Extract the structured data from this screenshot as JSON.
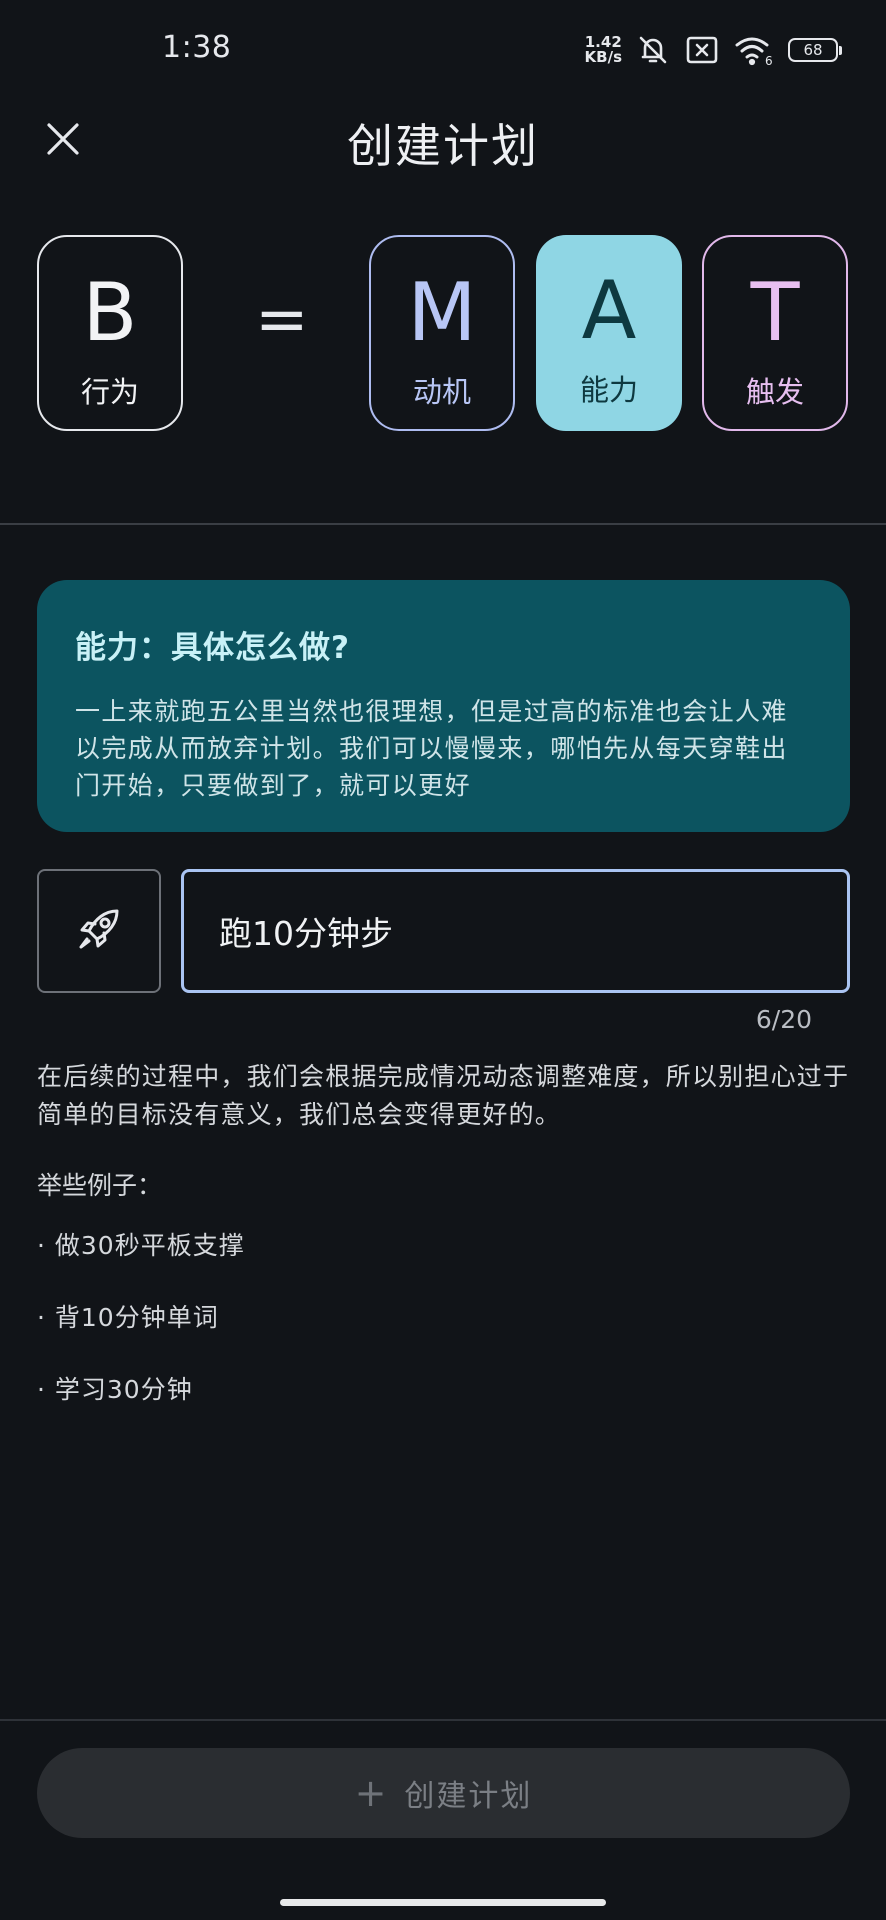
{
  "status_bar": {
    "time": "1:38",
    "net_speed_value": "1.42",
    "net_speed_unit": "KB/s",
    "battery_level": "68",
    "icons": [
      "bell-muted-icon",
      "sim-disabled-icon",
      "wifi-6-icon",
      "battery-icon"
    ]
  },
  "header": {
    "title": "创建计划",
    "close_icon": "close-icon"
  },
  "formula": {
    "equals": "=",
    "cards": [
      {
        "letter": "B",
        "label": "行为"
      },
      {
        "letter": "M",
        "label": "动机"
      },
      {
        "letter": "A",
        "label": "能力",
        "selected": true
      },
      {
        "letter": "T",
        "label": "触发"
      }
    ]
  },
  "info_card": {
    "title": "能力：具体怎么做?",
    "body": "一上来就跑五公里当然也很理想，但是过高的标准也会让人难以完成从而放弃计划。我们可以慢慢来，哪怕先从每天穿鞋出门开始，只要做到了，就可以更好"
  },
  "goal": {
    "icon": "rocket-icon",
    "value": "跑10分钟步",
    "counter": "6/20"
  },
  "guide": {
    "text": "在后续的过程中，我们会根据完成情况动态调整难度，所以别担心过于简单的目标没有意义，我们总会变得更好的。",
    "examples_title": "举些例子：",
    "examples": [
      "· 做30秒平板支撑",
      "· 背10分钟单词",
      "· 学习30分钟"
    ]
  },
  "footer": {
    "button_icon": "+",
    "button_label": "创建计划"
  },
  "colors": {
    "background": "#111418",
    "info_card": "#0c5460",
    "selected_card": "#8fd6e4",
    "motivation_border": "#aebcf0",
    "trigger_border": "#e1b8ea",
    "input_border": "#aac4f2"
  }
}
